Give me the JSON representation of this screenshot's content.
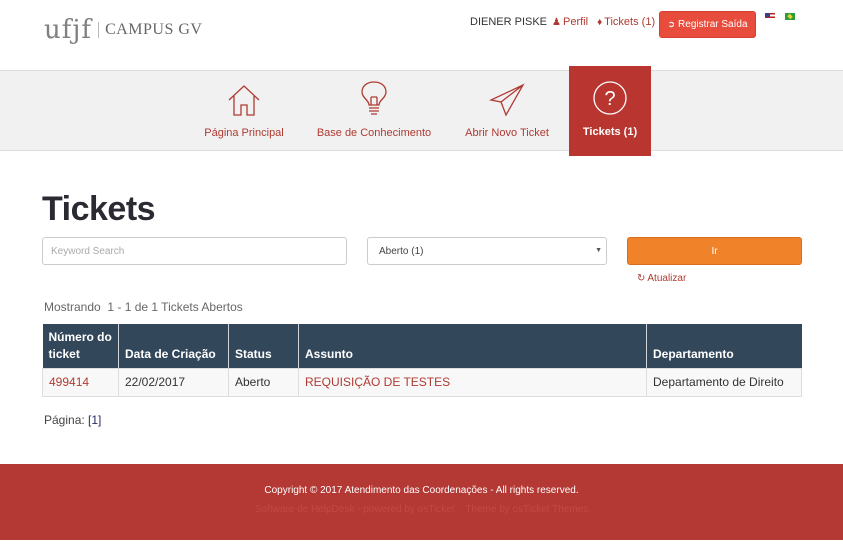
{
  "header": {
    "logo_text": "ufjf",
    "logo_sub": "CAMPUS GV",
    "user_name": "DIENER PISKE",
    "profile_label": "Perfil",
    "tickets_label": "Tickets (1)",
    "logout_label": "Registrar Saída",
    "languages": [
      "English",
      "Português (Brasil)"
    ]
  },
  "nav": {
    "items": [
      {
        "label": "Página Principal",
        "icon": "home-icon"
      },
      {
        "label": "Base de Conhecimento",
        "icon": "lightbulb-icon"
      },
      {
        "label": "Abrir Novo Ticket",
        "icon": "paper-plane-icon"
      },
      {
        "label": "Tickets (1)",
        "icon": "question-circle-icon",
        "active": true
      }
    ]
  },
  "page": {
    "title": "Tickets",
    "search_placeholder": "Keyword Search",
    "search_value": "",
    "filter_selected": "Aberto (1)",
    "go_label": "Ir",
    "refresh_label": "Atualizar",
    "showing": "Mostrando  1 - 1 de 1 Tickets Abertos"
  },
  "table": {
    "headers": [
      "Número do ticket",
      "Data de Criação",
      "Status",
      "Assunto",
      "Departamento"
    ],
    "rows": [
      {
        "number": "499414",
        "date": "22/02/2017",
        "status": "Aberto",
        "subject": "REQUISIÇÃO DE TESTES",
        "department": "Departamento de Direito"
      }
    ]
  },
  "pager": {
    "label": "Página:",
    "current": "[1]"
  },
  "footer": {
    "copyright": "Copyright © 2017 Atendimento das Coordenações - All rights reserved.",
    "powered": "Software de HelpDesk - powered by osTicket",
    "theme": "Theme by osTicket Themes"
  },
  "colors": {
    "brand_red": "#b8362f",
    "logout_red": "#e74c3c",
    "go_orange": "#f0822a",
    "table_header": "#33475b"
  }
}
